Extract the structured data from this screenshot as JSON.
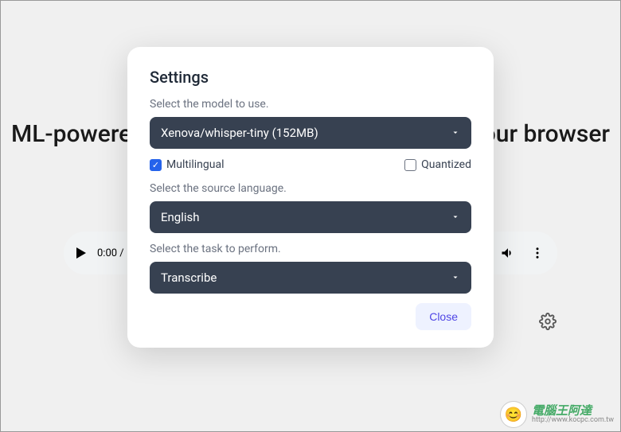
{
  "background": {
    "heading": "ML-powered speech recognition directly in your browser",
    "audio_time": "0:00 /"
  },
  "modal": {
    "title": "Settings",
    "model": {
      "label": "Select the model to use.",
      "value": "Xenova/whisper-tiny (152MB)"
    },
    "checkboxes": {
      "multilingual": {
        "label": "Multilingual",
        "checked": true
      },
      "quantized": {
        "label": "Quantized",
        "checked": false
      }
    },
    "language": {
      "label": "Select the source language.",
      "value": "English"
    },
    "task": {
      "label": "Select the task to perform.",
      "value": "Transcribe"
    },
    "close_label": "Close"
  },
  "watermark": {
    "main": "電腦王阿達",
    "sub": "http://www.kocpc.com.tw"
  }
}
